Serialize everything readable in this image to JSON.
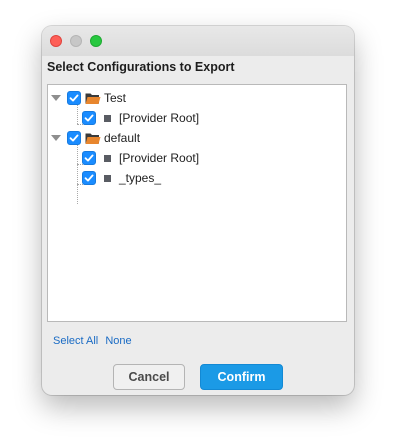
{
  "window": {
    "heading": "Select Configurations to Export"
  },
  "tree": {
    "nodes": [
      {
        "label": "Test",
        "type": "folder",
        "checked": true,
        "expanded": true
      },
      {
        "label": "[Provider Root]",
        "type": "item",
        "checked": true
      },
      {
        "label": "default",
        "type": "folder",
        "checked": true,
        "expanded": true
      },
      {
        "label": "[Provider Root]",
        "type": "item",
        "checked": true
      },
      {
        "label": "_types_",
        "type": "item",
        "checked": true
      }
    ]
  },
  "links": {
    "select_all": "Select All",
    "none": "None"
  },
  "buttons": {
    "cancel": "Cancel",
    "confirm": "Confirm"
  },
  "colors": {
    "accent": "#1b9ae6",
    "checkbox": "#1a8cff",
    "folder": "#e8862e",
    "link": "#1a6bc4"
  }
}
